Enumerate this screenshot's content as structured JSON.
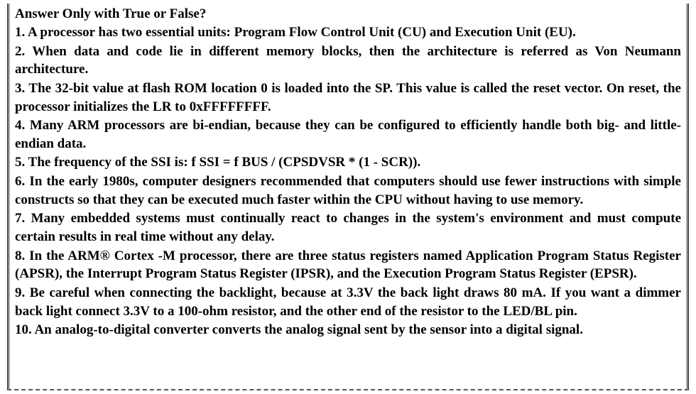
{
  "header": "Answer Only with True or False?",
  "questions": [
    "1. A processor has two essential units: Program Flow Control Unit (CU) and Execution Unit (EU).",
    "2. When data and code lie in different memory blocks, then the architecture is referred as Von Neumann architecture.",
    "3. The 32-bit value at flash ROM location 0 is loaded into the SP. This value is called the reset vector. On reset, the processor initializes the LR to 0xFFFFFFFF.",
    "4. Many ARM processors are bi-endian, because they can be configured to efficiently handle both big- and little-endian data.",
    "5. The frequency of the SSI is: f SSI = f BUS / (CPSDVSR * (1 - SCR)).",
    "6. In the early 1980s, computer designers recommended that computers should use fewer instructions with simple constructs so that they can be executed much faster within the CPU without having to use memory.",
    "7. Many embedded systems must continually react to changes in the system's environment and must compute certain results in real time without any delay.",
    "8. In the ARM® Cortex -M processor, there are three status registers named Application Program Status Register (APSR), the Interrupt Program Status Register (IPSR), and the Execution Program Status Register (EPSR).",
    "9. Be careful when connecting the backlight, because at 3.3V the back light draws 80 mA. If you want a dimmer back light connect 3.3V to a 100-ohm resistor, and the other end of the resistor to the LED/BL pin.",
    "10.  An analog-to-digital converter converts the analog signal sent by the sensor into a digital signal."
  ]
}
